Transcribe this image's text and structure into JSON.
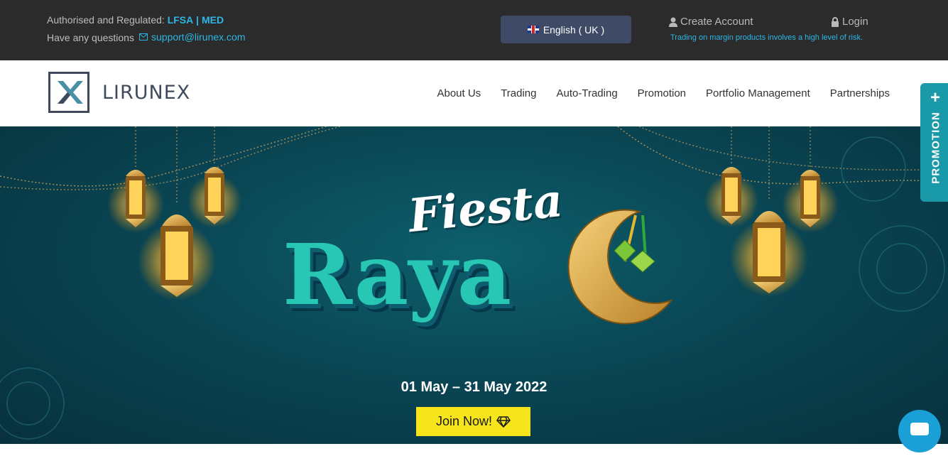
{
  "topbar": {
    "regulation_prefix": "Authorised and Regulated:",
    "regulator_1": "LFSA",
    "separator": "|",
    "regulator_2": "MED",
    "questions": "Have any questions",
    "support_email": "support@lirunex.com",
    "language": "English ( UK )",
    "create_account": "Create Account",
    "login": "Login",
    "risk_warning": "Trading on margin products involves a high level of risk."
  },
  "brand": {
    "name": "LIRUNEX"
  },
  "nav": {
    "items": [
      "About Us",
      "Trading",
      "Auto-Trading",
      "Promotion",
      "Portfolio Management",
      "Partnerships"
    ]
  },
  "hero": {
    "title_line1": "Fiesta",
    "title_line2": "Raya",
    "date_range": "01 May – 31 May 2022",
    "cta": "Join Now!"
  },
  "side_tab": {
    "label": "PROMOTION",
    "plus": "+"
  },
  "colors": {
    "topbar_bg": "#2b2b2b",
    "accent": "#2eb7e6",
    "cta": "#f7e51b",
    "promo_tab": "#1a9aa8"
  }
}
